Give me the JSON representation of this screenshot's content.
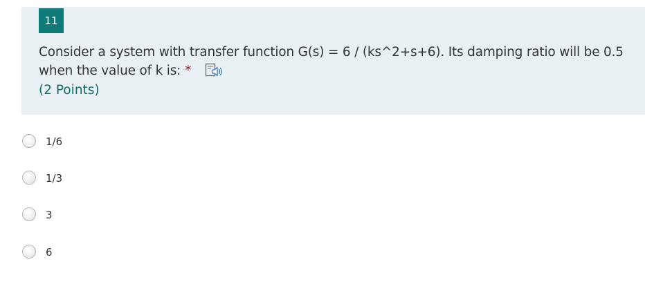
{
  "question": {
    "number": "11",
    "text": "Consider a system with transfer function G(s) = 6 / (ks^2+s+6). Its damping ratio will be 0.5 when the value of k is:",
    "required_mark": "*",
    "points": "(2 Points)",
    "icon": "immersive-reader-speaker-icon",
    "header_color": "#e9f0f3",
    "number_badge_color": "#0f7a78"
  },
  "options": [
    {
      "label": "1/6"
    },
    {
      "label": "1/3"
    },
    {
      "label": "3"
    },
    {
      "label": "6"
    }
  ]
}
